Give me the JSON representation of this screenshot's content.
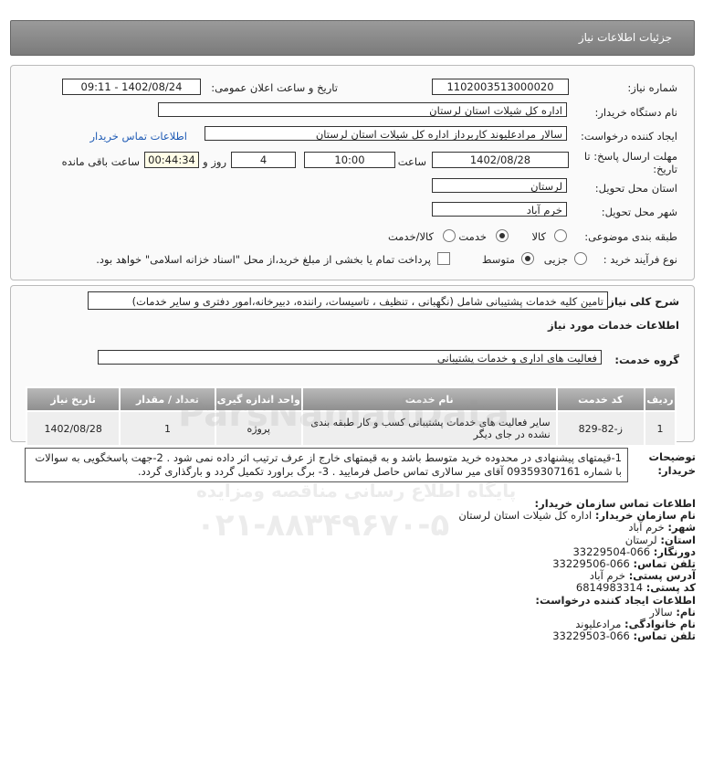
{
  "header": {
    "title": "جزئیات اطلاعات نیاز"
  },
  "form": {
    "need_number_label": "شماره نیاز:",
    "need_number": "1102003513000020",
    "announce_label": "تاریخ و ساعت اعلان عمومی:",
    "announce_value": "1402/08/24 - 09:11",
    "buyer_org_label": "نام دستگاه خریدار:",
    "buyer_org": "اداره کل شیلات استان لرستان",
    "requester_label": "ایجاد کننده درخواست:",
    "requester": "سالار مرادعلیوند کاربرداز اداره کل شیلات استان لرستان",
    "contact_link": "اطلاعات تماس خریدار",
    "deadline_label": "مهلت ارسال پاسخ: تا تاریخ:",
    "deadline_date": "1402/08/28",
    "time_label": "ساعت",
    "deadline_time": "10:00",
    "days_value": "4",
    "days_label": "روز و",
    "remaining_time": "00:44:34",
    "remaining_label": "ساعت باقی مانده",
    "province_label": "استان محل تحویل:",
    "province": "لرستان",
    "city_label": "شهر محل تحویل:",
    "city": "خرم آباد",
    "category_label": "طبقه بندی موضوعی:",
    "category_options": [
      "کالا",
      "خدمت",
      "کالا/خدمت"
    ],
    "category_selected": "خدمت",
    "process_label": "نوع فرآیند خرید :",
    "process_options": [
      "جزیی",
      "متوسط"
    ],
    "process_selected": "متوسط",
    "payment_note": "پرداخت تمام یا بخشی از مبلغ خرید،از محل \"اسناد خزانه اسلامی\" خواهد بود."
  },
  "summary": {
    "label": "شرح کلی نیاز:",
    "text": "تامین کلیه خدمات پشتیبانی شامل (نگهبانی ، تنظیف ، تاسیسات، راننده، دبیرخانه،امور دفتری و سایر خدمات)",
    "services_title": "اطلاعات خدمات مورد نیاز",
    "service_group_label": "گروه خدمت:",
    "service_group": "فعالیت های اداری و خدمات پشتیبانی"
  },
  "table": {
    "headers": [
      "ردیف",
      "کد خدمت",
      "نام خدمت",
      "واحد اندازه گیری",
      "تعداد / مقدار",
      "تاریخ نیاز"
    ],
    "rows": [
      {
        "row": "1",
        "code": "ز-82-829",
        "name": "سایر فعالیت های خدمات پشتیبانی کسب و کار طبقه بندی نشده در جای دیگر",
        "unit": "پروژه",
        "qty": "1",
        "date": "1402/08/28"
      }
    ]
  },
  "notes": {
    "label": "توضیحات خریدار:",
    "text": "1-قیمتهای پیشنهادی در محدوده خرید متوسط باشد و به قیمتهای خارج از عرف ترتیب اثر داده نمی شود . 2-جهت پاسخگویی به سوالات با شماره 09359307161 آقای میر سالاری تماس حاصل فرمایید . 3- برگ براورد تکمیل گردد و بارگذاری گردد."
  },
  "contact": {
    "buyer_title": "اطلاعات تماس سازمان خریدار:",
    "org_label": "نام سازمان خریدار:",
    "org_value": "اداره کل شیلات استان لرستان",
    "city_label": "شهر:",
    "city_value": "خرم آباد",
    "province_label": "استان:",
    "province_value": "لرستان",
    "fax_label": "دورنگار:",
    "fax_value": "066-33229504",
    "phone_label": "تلفن تماس:",
    "phone_value": "066-33229506",
    "address_label": "آدرس پستی:",
    "address_value": "خرم آباد",
    "postal_label": "کد پستی:",
    "postal_value": "6814983314",
    "creator_title": "اطلاعات ایجاد کننده درخواست:",
    "first_name_label": "نام:",
    "first_name_value": "سالار",
    "last_name_label": "نام خانوادگی:",
    "last_name_value": "مرادعلیوند",
    "creator_phone_label": "تلفن تماس:",
    "creator_phone_value": "066-33229503"
  },
  "watermark": {
    "brand": "ParsNamadData",
    "subtitle": "پایگاه اطلاع رسانی مناقصه ومزایده",
    "phone": "۰۲۱-۸۸۳۴۹۶۷۰-۵"
  }
}
